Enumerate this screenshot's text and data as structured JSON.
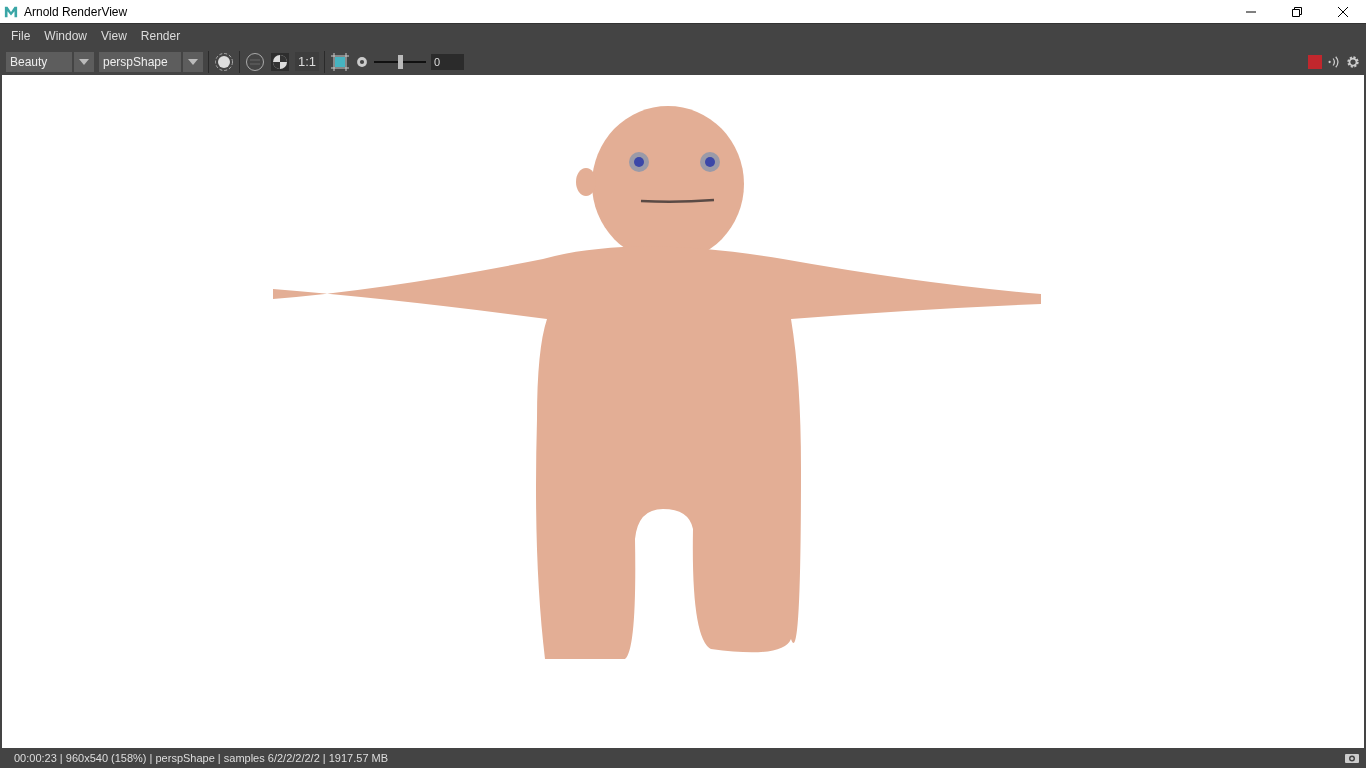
{
  "window": {
    "title": "Arnold RenderView"
  },
  "menu": [
    "File",
    "Window",
    "View",
    "Render"
  ],
  "toolbar": {
    "aov": "Beauty",
    "camera": "perspShape",
    "ratio": "1:1",
    "exposure": {
      "level": 0.5,
      "value": "0"
    }
  },
  "status_bar": {
    "text": "00:00:23 | 960x540 (158%) | perspShape  | samples 6/2/2/2/2/2 | 1917.57 MB"
  }
}
